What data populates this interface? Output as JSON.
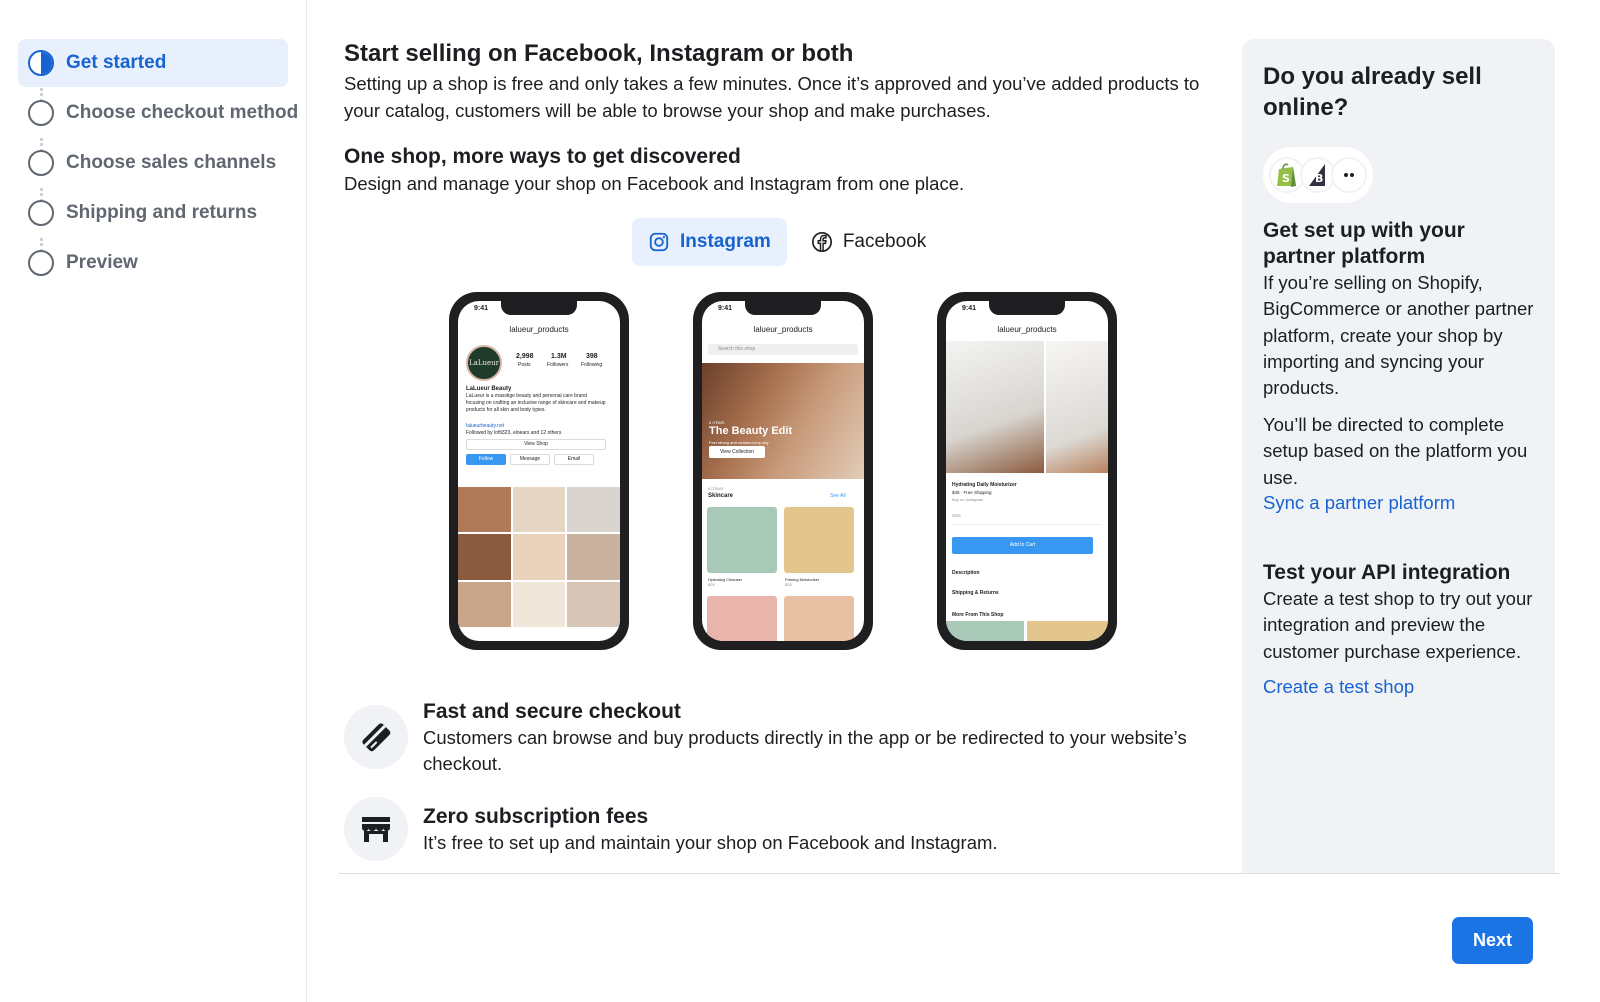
{
  "steps": [
    {
      "label": "Get started",
      "active": true
    },
    {
      "label": "Choose checkout method",
      "active": false
    },
    {
      "label": "Choose sales channels",
      "active": false
    },
    {
      "label": "Shipping and returns",
      "active": false
    },
    {
      "label": "Preview",
      "active": false
    }
  ],
  "main": {
    "title": "Start selling on Facebook, Instagram or both",
    "intro": "Setting up a shop is free and only takes a few minutes. Once it’s approved and you’ve added products to your catalog, customers will be able to browse your shop and make purchases.",
    "subtitle": "One shop, more ways to get discovered",
    "subtitle_desc": "Design and manage your shop on Facebook and Instagram from one place.",
    "tabs": [
      {
        "label": "Instagram",
        "icon": "instagram-icon",
        "active": true
      },
      {
        "label": "Facebook",
        "icon": "facebook-icon",
        "active": false
      }
    ],
    "phones": {
      "profile": {
        "time": "9:41",
        "handle": "lalueur_products",
        "avatar_text": "LaLueur",
        "posts": "2,998",
        "posts_label": "Posts",
        "followers": "1.3M",
        "followers_label": "Followers",
        "following": "398",
        "following_label": "Following",
        "name": "LaLueur Beauty",
        "bio": "LaLueur is a masstige beauty and personal care brand focusing on crafting an inclusive range of skincare and makeup products for all skin and body types.",
        "link": "lalueurbeauty.net",
        "followed_by": "Followed by lofti323, eloears and 12 others",
        "view_shop": "View Shop",
        "follow": "Follow",
        "message": "Message",
        "email": "Email"
      },
      "shop": {
        "time": "9:41",
        "handle": "lalueur_products",
        "search": "Search this shop",
        "count": "6 ITEMS",
        "collection": "The Beauty Edit",
        "tagline": "Feel strong and radiant every day",
        "view_collection": "View Collection",
        "items_count": "6 ITEMS",
        "section": "Skincare",
        "see_all": "See All",
        "item1": "Hydrating Cleanser",
        "item1_price": "$25",
        "item2": "Priming Moisturizer",
        "item2_price": "$25"
      },
      "product": {
        "time": "9:41",
        "handle": "lalueur_products",
        "name": "Hydrating Daily Moisturizer",
        "price": "$45 · Free Shipping",
        "on": "Buy on Instagram",
        "size": "Size",
        "add_to_cart": "Add to Cart",
        "description": "Description",
        "shipping": "Shipping & Returns",
        "more": "More From This Shop"
      }
    },
    "features": [
      {
        "icon": "card-icon",
        "title": "Fast and secure checkout",
        "desc": "Customers can browse and buy products directly in the app or be redirected to your website’s checkout."
      },
      {
        "icon": "storefront-icon",
        "title": "Zero subscription fees",
        "desc": "It’s free to set up and maintain your shop on Facebook and Instagram."
      }
    ],
    "next_label": "Next"
  },
  "side": {
    "title": "Do you already sell online?",
    "partner_title": "Get set up with your partner platform",
    "partner_desc": "If you’re selling on Shopify, BigCommerce or another partner platform, create your shop by importing and syncing your products.",
    "partner_desc2": "You’ll be directed to complete setup based on the platform you use.",
    "partner_link": "Sync a partner platform",
    "api_title": "Test your API integration",
    "api_desc": "Create a test shop to try out your integration and preview the customer purchase experience.",
    "api_link": "Create a test shop",
    "logos": [
      "shopify-icon",
      "bigcommerce-icon",
      "more-icon"
    ]
  },
  "colors": {
    "accent": "#1763cf",
    "button": "#1b74e4",
    "active_bg": "#e7f0fc",
    "panel_bg": "#f0f2f5",
    "shopify_green": "#95bf47"
  }
}
